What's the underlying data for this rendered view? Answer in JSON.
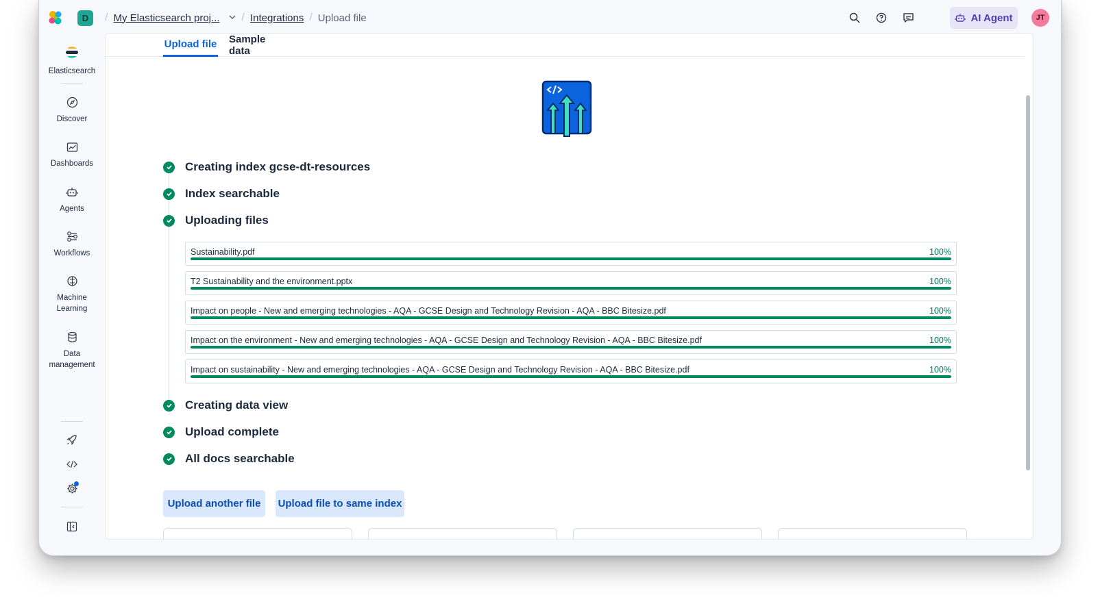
{
  "header": {
    "space_initial": "D",
    "breadcrumbs": {
      "project": "My Elasticsearch proj...",
      "integrations": "Integrations",
      "current": "Upload file"
    },
    "ai_agent_label": "AI Agent",
    "avatar_initials": "JT",
    "icons": [
      "search-icon",
      "help-icon",
      "feedback-icon"
    ]
  },
  "sidebar": {
    "brand_label": "Elasticsearch",
    "items": [
      {
        "label": "Discover",
        "icon": "discover-icon"
      },
      {
        "label": "Dashboards",
        "icon": "dashboards-icon"
      },
      {
        "label": "Agents",
        "icon": "agents-icon"
      },
      {
        "label": "Workflows",
        "icon": "workflows-icon"
      },
      {
        "label": "Machine Learning",
        "icon": "machine-learning-icon"
      },
      {
        "label": "Data management",
        "icon": "data-management-icon"
      }
    ],
    "footer_icons": [
      "rocket-icon",
      "code-icon",
      "settings-icon",
      "collapse-icon"
    ]
  },
  "tabs": [
    {
      "label": "Upload file",
      "active": true
    },
    {
      "label": "Sample data",
      "active": false
    }
  ],
  "steps": [
    "Creating index gcse-dt-resources",
    "Index searchable",
    "Uploading files",
    "Creating data view",
    "Upload complete",
    "All docs searchable"
  ],
  "files": [
    {
      "name": "Sustainability.pdf",
      "progress_label": "100%",
      "progress": 1.0
    },
    {
      "name": "T2 Sustainability and the environment.pptx",
      "progress_label": "100%",
      "progress": 1.0
    },
    {
      "name": "Impact on people - New and emerging technologies - AQA - GCSE Design and Technology Revision - AQA - BBC Bitesize.pdf",
      "progress_label": "100%",
      "progress": 1.0
    },
    {
      "name": "Impact on the environment - New and emerging technologies - AQA - GCSE Design and Technology Revision - AQA - BBC Bitesize.pdf",
      "progress_label": "100%",
      "progress": 1.0
    },
    {
      "name": "Impact on sustainability - New and emerging technologies - AQA - GCSE Design and Technology Revision - AQA - BBC Bitesize.pdf",
      "progress_label": "100%",
      "progress": 1.0
    }
  ],
  "actions": {
    "upload_another": "Upload another file",
    "upload_same_index": "Upload file to same index"
  },
  "colors": {
    "accent": "#0b64dd",
    "success": "#008a5e",
    "ai_agent_bg": "#e8e4f8",
    "button_bg": "#d9e8fc"
  }
}
